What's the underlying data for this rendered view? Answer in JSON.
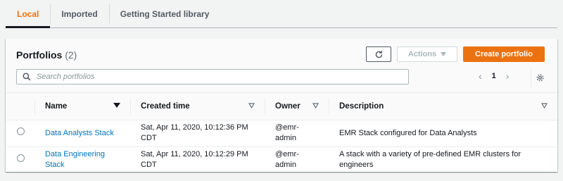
{
  "tabs": [
    {
      "label": "Local",
      "active": true
    },
    {
      "label": "Imported",
      "active": false
    },
    {
      "label": "Getting Started library",
      "active": false
    }
  ],
  "panel": {
    "title": "Portfolios",
    "count": "(2)",
    "refresh_icon": "refresh-icon",
    "actions_label": "Actions",
    "create_label": "Create portfolio",
    "search_placeholder": "Search portfolios",
    "search_value": "",
    "page_number": "1"
  },
  "table": {
    "headers": [
      "Name",
      "Created time",
      "Owner",
      "Description"
    ],
    "rows": [
      {
        "name": "Data Analysts Stack",
        "created_line1": "Sat, Apr 11, 2020, 10:12:36 PM",
        "created_line2": "CDT",
        "owner_line1": "@emr-",
        "owner_line2": "admin",
        "description": "EMR Stack configured for Data Analysts"
      },
      {
        "name_line1": "Data Engineering",
        "name_line2": "Stack",
        "created_line1": "Sat, Apr 11, 2020, 10:12:29 PM",
        "created_line2": "CDT",
        "owner_line1": "@emr-",
        "owner_line2": "admin",
        "description_line1": "A stack with a variety of pre-defined EMR clusters for",
        "description_line2": "engineers"
      }
    ]
  },
  "colors": {
    "accent": "#ec7211",
    "link": "#0073bb",
    "text": "#16191f",
    "muted": "#879596",
    "background": "#f2f3f3"
  }
}
